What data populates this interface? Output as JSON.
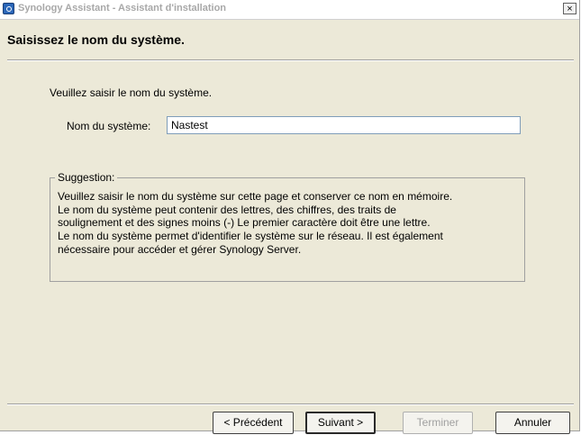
{
  "window": {
    "title": "Synology Assistant - Assistant d'installation",
    "close_glyph": "×"
  },
  "header": {
    "title": "Saisissez le nom du système."
  },
  "form": {
    "instruction": "Veuillez saisir le nom du système.",
    "name_label": "Nom du système:",
    "name_value": "Nastest"
  },
  "suggestion": {
    "legend": "Suggestion:",
    "lines": [
      "Veuillez saisir le nom du système sur cette page et conserver ce nom en mémoire.",
      "Le nom du système peut contenir des lettres, des chiffres, des traits de",
      "soulignement et des signes moins (-) Le premier caractère doit être une lettre.",
      "Le nom du système permet d'identifier le système sur le réseau. Il est également",
      "nécessaire pour accéder et gérer Synology Server."
    ]
  },
  "buttons": {
    "previous": "< Précédent",
    "next": "Suivant >",
    "finish": "Terminer",
    "cancel": "Annuler"
  }
}
